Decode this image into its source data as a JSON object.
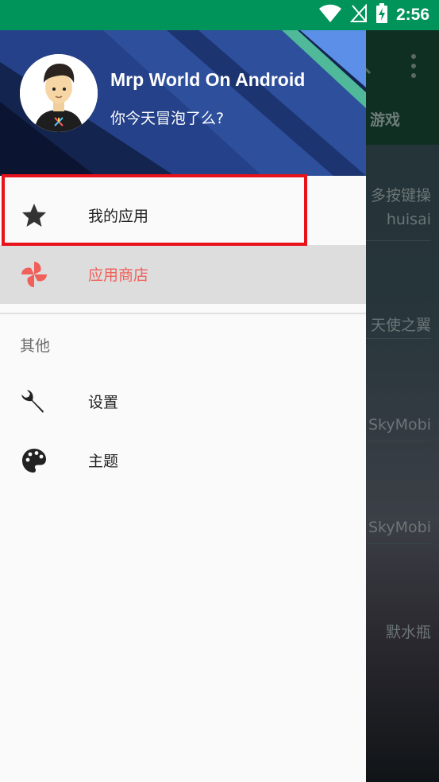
{
  "status_bar": {
    "time": "2:56"
  },
  "background_app": {
    "tab_label": "游戏",
    "list_items": [
      "多按键操",
      "huisai",
      "天使之翼",
      "SkyMobi",
      "SkyMobi",
      "默水瓶"
    ]
  },
  "drawer": {
    "header": {
      "title": "Mrp World On Android",
      "subtitle": "你今天冒泡了么?"
    },
    "nav_items": [
      {
        "label": "我的应用",
        "icon": "star-icon",
        "active": false
      },
      {
        "label": "应用商店",
        "icon": "pinwheel-icon",
        "active": true
      }
    ],
    "section_title": "其他",
    "other_items": [
      {
        "label": "设置",
        "icon": "wrench-icon"
      },
      {
        "label": "主题",
        "icon": "palette-icon"
      }
    ]
  },
  "colors": {
    "status_bar": "#00935a",
    "active_label": "#f0605a",
    "highlight_box": "#e8121b"
  }
}
